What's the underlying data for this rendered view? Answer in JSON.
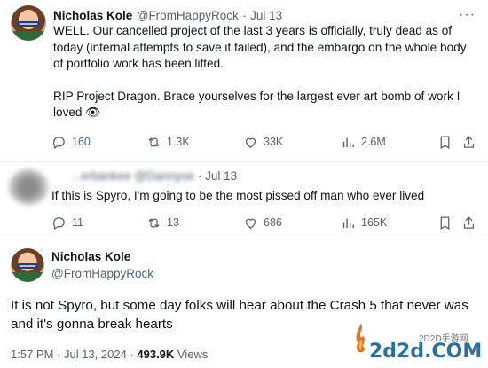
{
  "tweet1": {
    "name": "Nicholas Kole",
    "handle": "@FromHappyRock",
    "separator": "·",
    "date": "Jul 13",
    "text_p1": "WELL. Our cancelled project of the last 3 years is officially, truly dead as of today (internal attempts to save it failed), and the embargo on the whole body of portfolio work has been lifted.",
    "text_p2": "RIP Project Dragon. Brace yourselves for the largest ever art bomb of work I loved",
    "emoji": "👁",
    "replies": "160",
    "reposts": "1.3K",
    "likes": "33K",
    "views": "2.6M"
  },
  "tweet2": {
    "name_blurred": "...erbankee",
    "handle_blurred": "@Dannyoe",
    "separator": "·",
    "date": "Jul 13",
    "text": "If this is Spyro, I'm going to be the most pissed off man who ever lived",
    "replies": "11",
    "reposts": "13",
    "likes": "686",
    "views": "165K"
  },
  "tweet3": {
    "name": "Nicholas Kole",
    "handle": "@FromHappyRock",
    "text": "It is not Spyro, but some day folks will hear about the Crash 5 that never was and it's gonna break hearts",
    "time": "1:57 PM · Jul 13, 2024 ·",
    "views_count": "493.9K",
    "views_label": "Views"
  },
  "watermark": {
    "top": "2D2D手游网",
    "main": "2d2d.COM"
  },
  "colors": {
    "text_primary": "#0f1419",
    "text_secondary": "#536471",
    "divider": "#e6ecf0"
  },
  "icons": [
    "reply-icon",
    "repost-icon",
    "like-icon",
    "views-icon",
    "bookmark-icon",
    "share-icon",
    "more-icon"
  ]
}
